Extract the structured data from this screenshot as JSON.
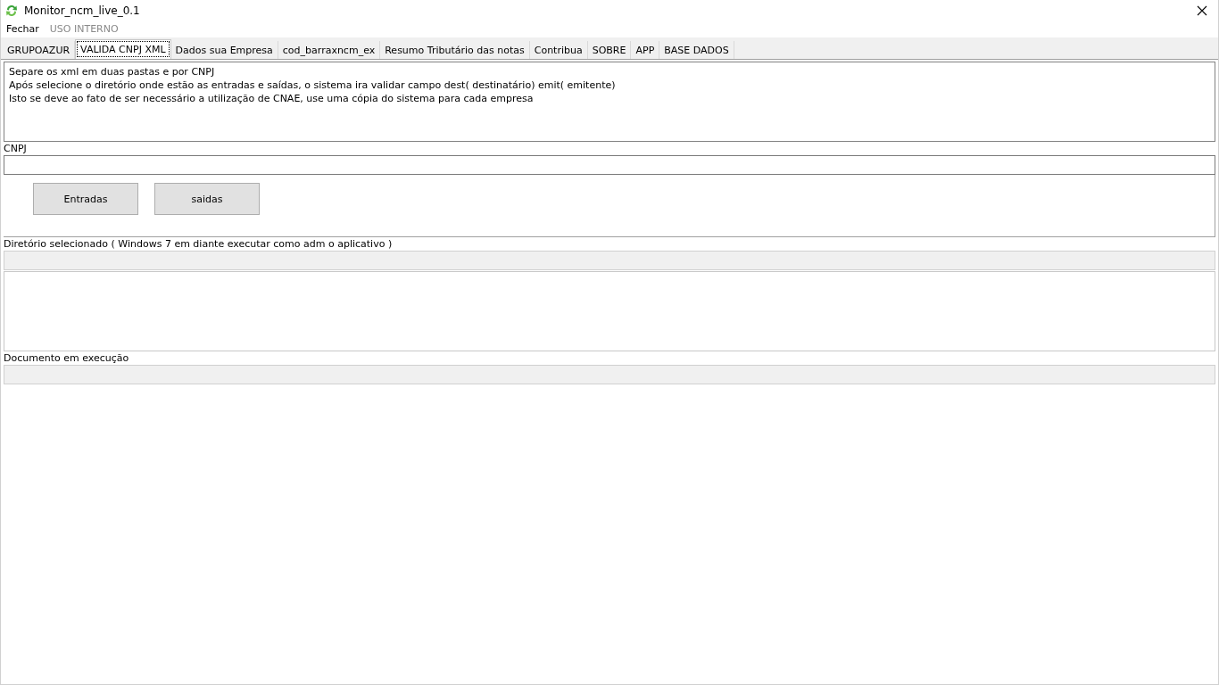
{
  "window": {
    "title": "Monitor_ncm_live_0.1"
  },
  "menu": [
    {
      "label": "Fechar",
      "disabled": false
    },
    {
      "label": "USO INTERNO",
      "disabled": true
    }
  ],
  "tabs": [
    {
      "label": "GRUPOAZUR",
      "selected": false
    },
    {
      "label": "VALIDA CNPJ XML",
      "selected": true
    },
    {
      "label": "Dados sua Empresa",
      "selected": false
    },
    {
      "label": "cod_barraxncm_ex",
      "selected": false
    },
    {
      "label": "Resumo Tributário das notas",
      "selected": false
    },
    {
      "label": "Contribua",
      "selected": false
    },
    {
      "label": "SOBRE",
      "selected": false
    },
    {
      "label": "APP",
      "selected": false
    },
    {
      "label": "BASE DADOS",
      "selected": false
    }
  ],
  "instructions": [
    "Separe os xml em duas pastas e por CNPJ",
    "Após selecione o diretório onde estão as entradas e saídas, o sistema ira validar campo dest( destinatário) emit( emitente)",
    "Isto se deve ao fato de ser necessário a utilização de CNAE, use uma cópia do sistema para cada empresa"
  ],
  "cnpj": {
    "label": "CNPJ"
  },
  "buttons": [
    "Entradas",
    "saidas"
  ],
  "directory": {
    "label": "Diretório selecionado ( Windows 7 em diante executar como adm o aplicativo )"
  },
  "document": {
    "label": "Documento em execução"
  }
}
